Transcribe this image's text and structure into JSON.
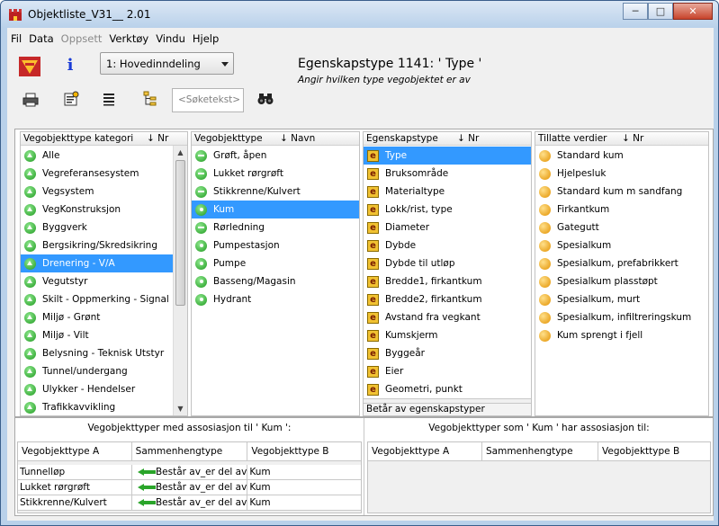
{
  "window": {
    "title": "Objektliste_V31__ 2.01",
    "minimize": "─",
    "maximize": "□",
    "close": "✕"
  },
  "menu": [
    {
      "label": "Fil",
      "enabled": true
    },
    {
      "label": "Data",
      "enabled": true
    },
    {
      "label": "Oppsett",
      "enabled": false
    },
    {
      "label": "Verktøy",
      "enabled": true
    },
    {
      "label": "Vindu",
      "enabled": true
    },
    {
      "label": "Hjelp",
      "enabled": true
    }
  ],
  "toolbar": {
    "info_icon": "info-icon",
    "dropdown_value": "1: Hovedinndeling",
    "search_placeholder": "<Søketekst>"
  },
  "property": {
    "title": "Egenskapstype 1141:  ' Type '",
    "description": "Angir hvilken type vegobjektet er av"
  },
  "categories": {
    "header": "Vegobjekttype kategori",
    "sort": "↓ Nr",
    "items": [
      "Alle",
      "Vegreferansesystem",
      "Vegsystem",
      "VegKonstruksjon",
      "Byggverk",
      "Bergsikring/Skredsikring",
      "Drenering - V/A",
      "Vegutstyr",
      "Skilt - Oppmerking - Signal",
      "Miljø - Grønt",
      "Miljø - Vilt",
      "Belysning - Teknisk Utstyr",
      "Tunnel/undergang",
      "Ulykker - Hendelser",
      "Trafikkavvikling"
    ],
    "selected": "Drenering - V/A"
  },
  "object_types": {
    "header": "Vegobjekttype",
    "sort": "↓ Navn",
    "items": [
      {
        "label": "Grøft, åpen",
        "icon": "minus"
      },
      {
        "label": "Lukket rørgrøft",
        "icon": "minus"
      },
      {
        "label": "Stikkrenne/Kulvert",
        "icon": "minus"
      },
      {
        "label": "Kum",
        "icon": "dot"
      },
      {
        "label": "Rørledning",
        "icon": "minus"
      },
      {
        "label": "Pumpestasjon",
        "icon": "dot"
      },
      {
        "label": "Pumpe",
        "icon": "dot"
      },
      {
        "label": "Basseng/Magasin",
        "icon": "dot"
      },
      {
        "label": "Hydrant",
        "icon": "dot"
      }
    ],
    "selected": "Kum"
  },
  "property_types": {
    "header": "Egenskapstype",
    "sort": "↓ Nr",
    "items": [
      "Type",
      "Bruksområde",
      "Materialtype",
      "Lokk/rist, type",
      "Diameter",
      "Dybde",
      "Dybde til utløp",
      "Bredde1, firkantkum",
      "Bredde2, firkantkum",
      "Avstand fra vegkant",
      "Kumskjerm",
      "Byggeår",
      "Eier",
      "Geometri, punkt"
    ],
    "selected": "Type",
    "footer_scrolled": "Betår av egenskapstyper",
    "footer": "Betår av egenskapstyper"
  },
  "allowed_values": {
    "header": "Tillatte verdier",
    "sort": "↓ Nr",
    "items": [
      "Standard kum",
      "Hjelpesluk",
      "Standard kum m sandfang",
      "Firkantkum",
      "Gategutt",
      "Spesialkum",
      "Spesialkum, prefabrikkert",
      "Spesialkum plasstøpt",
      "Spesialkum, murt",
      "Spesialkum, infiltreringskum",
      "Kum sprengt i fjell"
    ]
  },
  "assoc_left": {
    "title": "Vegobjekttyper med assosiasjon til ' Kum ':",
    "columns": [
      "Vegobjekttype A",
      "Sammenhengtype",
      "Vegobjekttype B"
    ],
    "rows": [
      {
        "a": "Tunnelløp",
        "rel": "Består av_er del av",
        "b": "Kum"
      },
      {
        "a": "Lukket rørgrøft",
        "rel": "Består av_er del av",
        "b": "Kum"
      },
      {
        "a": "Stikkrenne/Kulvert",
        "rel": "Består av_er del av",
        "b": "Kum"
      }
    ]
  },
  "assoc_right": {
    "title": "Vegobjekttyper som ' Kum ' har assosiasjon til:",
    "columns": [
      "Vegobjekttype A",
      "Sammenhengtype",
      "Vegobjekttype B"
    ]
  }
}
